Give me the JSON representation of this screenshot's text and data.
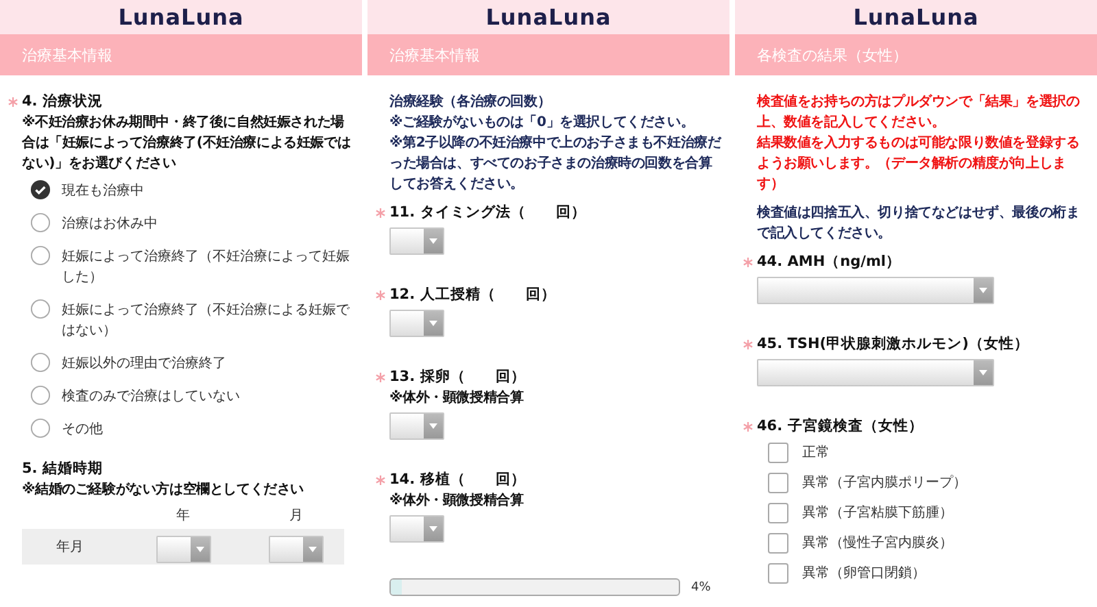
{
  "panels": [
    {
      "logo": "LunaLuna",
      "section": "治療基本情報",
      "blocks": [
        {
          "kind": "question",
          "required": true,
          "title": "4. 治療状況",
          "note": "※不妊治療お休み期間中・終了後に自然妊娠された場合は「妊娠によって治療終了(不妊治療による妊娠ではない)」をお選びください"
        },
        {
          "kind": "radio",
          "label": "現在も治療中",
          "selected": true
        },
        {
          "kind": "radio",
          "label": "治療はお休み中",
          "selected": false
        },
        {
          "kind": "radio",
          "label": "妊娠によって治療終了（不妊治療によって妊娠した）",
          "selected": false
        },
        {
          "kind": "radio",
          "label": "妊娠によって治療終了（不妊治療による妊娠ではない）",
          "selected": false
        },
        {
          "kind": "radio",
          "label": "妊娠以外の理由で治療終了",
          "selected": false
        },
        {
          "kind": "radio",
          "label": "検査のみで治療はしていない",
          "selected": false
        },
        {
          "kind": "radio",
          "label": "その他",
          "selected": false
        },
        {
          "kind": "question",
          "required": false,
          "title": "5. 結婚時期",
          "note": "※結婚のご経験がない方は空欄としてください"
        },
        {
          "kind": "date_row",
          "label": "年月",
          "columns": [
            "年",
            "月"
          ]
        }
      ]
    },
    {
      "logo": "LunaLuna",
      "section": "治療基本情報",
      "blocks": [
        {
          "kind": "info",
          "color": "#1e2a5a",
          "lines": [
            "治療経験（各治療の回数）",
            "※ご経験がないものは「0」を選択してください。",
            "※第2子以降の不妊治療中で上のお子さまも不妊治療だった場合は、すべてのお子さまの治療時の回数を合算してお答えください。"
          ]
        },
        {
          "kind": "question",
          "required": true,
          "title": "11. タイミング法（　　回）"
        },
        {
          "kind": "select_small"
        },
        {
          "kind": "question",
          "required": true,
          "title": "12. 人工授精（　　回）"
        },
        {
          "kind": "select_small"
        },
        {
          "kind": "question",
          "required": true,
          "title": "13. 採卵（　　回）",
          "note": "※体外・顕微授精合算"
        },
        {
          "kind": "select_small"
        },
        {
          "kind": "question",
          "required": true,
          "title": "14. 移植（　　回）",
          "note": "※体外・顕微授精合算"
        },
        {
          "kind": "select_small"
        },
        {
          "kind": "progress",
          "level": 0.04,
          "label": "4%"
        }
      ]
    },
    {
      "logo": "LunaLuna",
      "section": "各検査の結果（女性）",
      "blocks": [
        {
          "kind": "info",
          "color": "#f01414",
          "lines": [
            "検査値をお持ちの方はプルダウンで「結果」を選択の上、数値を記入してください。",
            "結果数値を入力するものは可能な限り数値を登録するようお願いします。（データ解析の精度が向上します）"
          ]
        },
        {
          "kind": "info",
          "color": "#1e2a5a",
          "lines": [
            "検査値は四捨五入、切り捨てなどはせず、最後の桁まで記入してください。"
          ]
        },
        {
          "kind": "question",
          "required": true,
          "title": "44. AMH（ng/ml）"
        },
        {
          "kind": "select_wide"
        },
        {
          "kind": "question",
          "required": true,
          "title": "45. TSH(甲状腺刺激ホルモン)（女性）"
        },
        {
          "kind": "select_wide"
        },
        {
          "kind": "question",
          "required": true,
          "title": "46. 子宮鏡検査（女性）"
        },
        {
          "kind": "checkbox",
          "label": "正常",
          "checked": false
        },
        {
          "kind": "checkbox",
          "label": "異常（子宮内膜ポリープ）",
          "checked": false
        },
        {
          "kind": "checkbox",
          "label": "異常（子宮粘膜下筋腫）",
          "checked": false
        },
        {
          "kind": "checkbox",
          "label": "異常（慢性子宮内膜炎）",
          "checked": false
        },
        {
          "kind": "checkbox",
          "label": "異常（卵管口閉鎖）",
          "checked": false
        }
      ]
    }
  ]
}
